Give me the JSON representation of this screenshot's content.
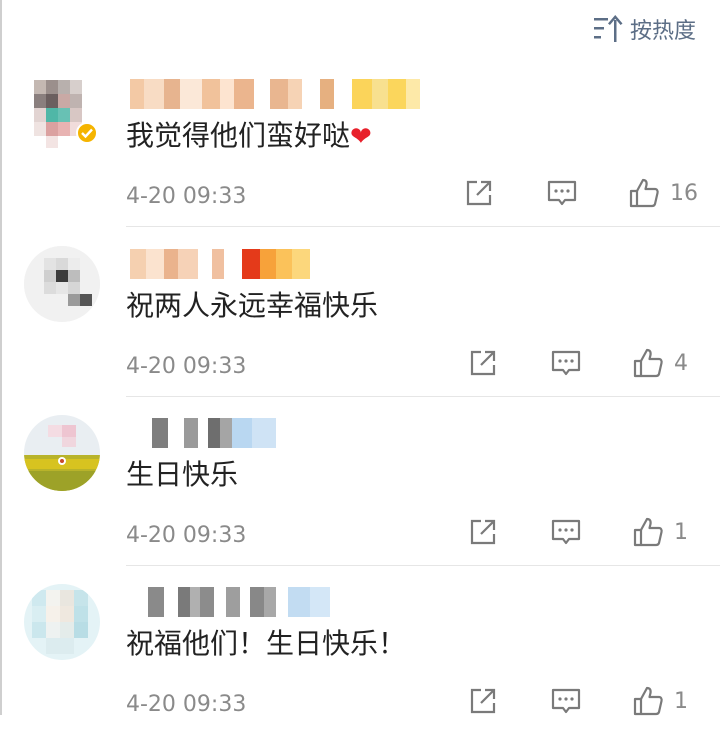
{
  "sort": {
    "label": "按热度",
    "icon": "sort-icon"
  },
  "comments": [
    {
      "text": "我觉得他们蛮好哒",
      "emoji": "❤",
      "time": "4-20 09:33",
      "likes": "16"
    },
    {
      "text": "祝两人永远幸福快乐",
      "time": "4-20 09:33",
      "likes": "4"
    },
    {
      "text": "生日快乐",
      "time": "4-20 09:33",
      "likes": "1"
    },
    {
      "text": "祝福他们！生日快乐！",
      "time": "4-20 09:33",
      "likes": "1"
    }
  ],
  "colors": {
    "accent": "#5c6e86",
    "icon": "#7a7a7a",
    "heart": "#e8202b",
    "time": "#8a8a8a"
  }
}
